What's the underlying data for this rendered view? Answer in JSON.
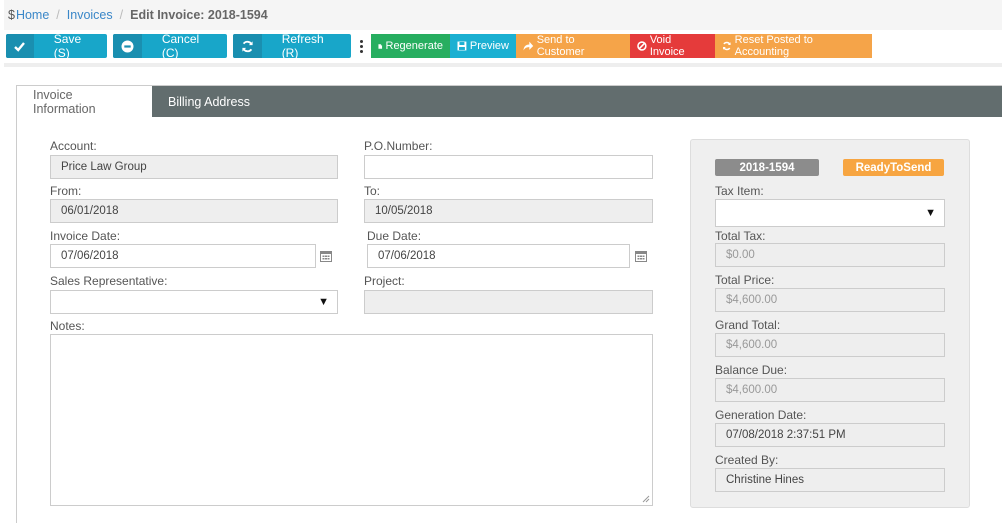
{
  "breadcrumb": {
    "icon": "dollar-icon",
    "home": "Home",
    "invoices": "Invoices",
    "current": "Edit Invoice: 2018-1594"
  },
  "toolbar": {
    "save": "Save (S)",
    "cancel": "Cancel (C)",
    "refresh": "Refresh (R)",
    "regenerate": "Regenerate",
    "preview": "Preview",
    "send": "Send to Customer",
    "void": "Void Invoice",
    "reset": "Reset Posted to Accounting",
    "colors": {
      "primary": "#18a6c9",
      "green": "#27ae60",
      "teal": "#1bb0d2",
      "orange": "#f5a449",
      "red": "#e53b3b"
    }
  },
  "tabs": {
    "invoice_info": "Invoice Information",
    "billing_address": "Billing Address"
  },
  "form": {
    "account": {
      "label": "Account:",
      "value": "Price Law Group"
    },
    "po_number": {
      "label": "P.O.Number:",
      "value": ""
    },
    "from": {
      "label": "From:",
      "value": "06/01/2018"
    },
    "to": {
      "label": "To:",
      "value": "10/05/2018"
    },
    "invoice_date": {
      "label": "Invoice Date:",
      "value": "07/06/2018"
    },
    "due_date": {
      "label": "Due Date:",
      "value": "07/06/2018"
    },
    "sales_rep": {
      "label": "Sales Representative:",
      "value": ""
    },
    "project": {
      "label": "Project:",
      "value": ""
    },
    "notes": {
      "label": "Notes:",
      "value": ""
    }
  },
  "summary": {
    "invoice_number": "2018-1594",
    "status": "ReadyToSend",
    "status_color": "#f7a541",
    "number_color": "#8c8c8c",
    "tax_item": {
      "label": "Tax Item:",
      "value": ""
    },
    "total_tax": {
      "label": "Total Tax:",
      "value": "$0.00"
    },
    "total_price": {
      "label": "Total Price:",
      "value": "$4,600.00"
    },
    "grand_total": {
      "label": "Grand Total:",
      "value": "$4,600.00"
    },
    "balance_due": {
      "label": "Balance Due:",
      "value": "$4,600.00"
    },
    "generation_date": {
      "label": "Generation Date:",
      "value": "07/08/2018 2:37:51 PM"
    },
    "created_by": {
      "label": "Created By:",
      "value": "Christine Hines"
    }
  }
}
